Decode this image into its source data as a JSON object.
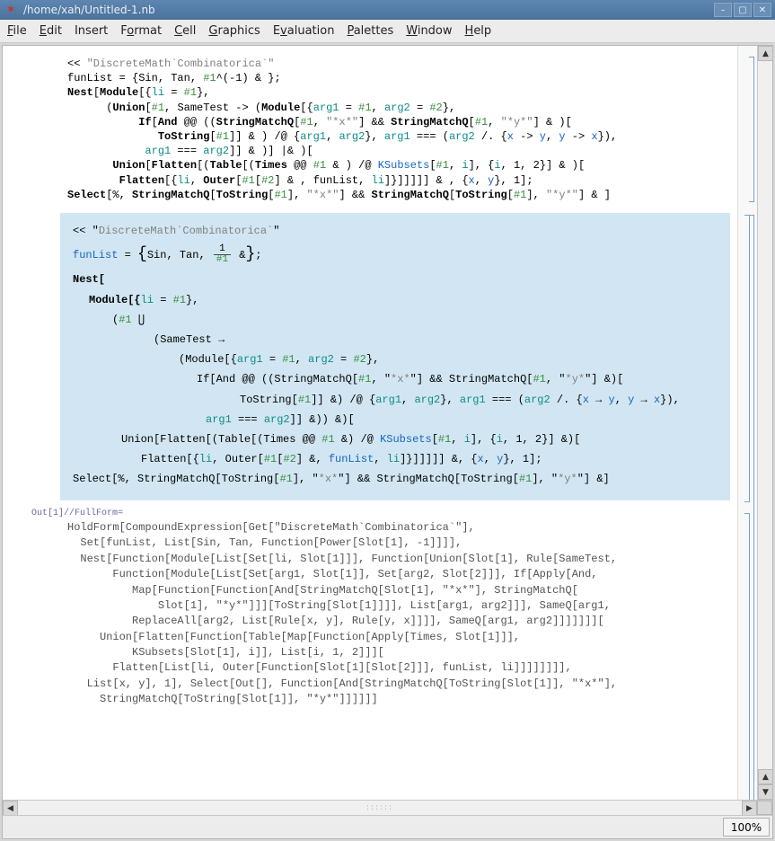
{
  "window": {
    "title": "/home/xah/Untitled-1.nb"
  },
  "menu": {
    "file": "File",
    "edit": "Edit",
    "insert": "Insert",
    "format": "Format",
    "cell": "Cell",
    "graphics": "Graphics",
    "evaluation": "Evaluation",
    "palettes": "Palettes",
    "window": "Window",
    "help": "Help"
  },
  "status": {
    "zoom": "100%"
  },
  "code": {
    "raw_input": "<< \"DiscreteMath`Combinatorica`\"\nfunList = {Sin, Tan, #1^(-1) & };\nNest[Module[{li = #1},\n      (Union[#1, SameTest -> (Module[{arg1 = #1, arg2 = #2},\n           If[And @@ ((StringMatchQ[#1, \"*x*\"] && StringMatchQ[#1, \"*y*\"] & )[\n              ToString[#1]] & ) /@ {arg1, arg2}, arg1 === (arg2 /. {x -> y, y -> x}),\n            arg1 === arg2]] & )] |& )[\n       Union[Flatten[(Table[(Times @@ #1 & ) /@ KSubsets[#1, i], {i, 1, 2}] & )[\n        Flatten[{li, Outer[#1[#2] & , funList, li]}]]]]] & , {x, y}, 1];\nSelect[%, StringMatchQ[ToString[#1], \"*x*\"] && StringMatchQ[ToString[#1], \"*y*\"] & ]",
    "formatted": {
      "l1a": "<< \"",
      "l1b": "DiscreteMath`Combinatorica`",
      "l1c": "\"",
      "l2a": "funList",
      "l2b": " = ",
      "l2c": "Sin",
      "l2d": ", ",
      "l2e": "Tan",
      "l2f": ", ",
      "l2_frac_num": "1",
      "l2_frac_den": "#1",
      "l2g": " &",
      "l2h": ";",
      "l3": "Nest[",
      "l4a": "Module[{",
      "l4b": "li",
      "l4c": " = ",
      "l4d": "#1",
      "l4e": "},",
      "l5a": "(",
      "l5b": "#1",
      "l5c": " ⋃",
      "l6": "(SameTest →",
      "l7a": "(Module[{",
      "l7b": "arg1",
      "l7c": " = ",
      "l7d": "#1",
      "l7e": ", ",
      "l7f": "arg2",
      "l7g": " = ",
      "l7h": "#2",
      "l7i": "},",
      "l8a": "If[And @@ ((StringMatchQ[",
      "l8b": "#1",
      "l8c": ", \"",
      "l8d": "*x*",
      "l8e": "\"] && StringMatchQ[",
      "l8f": "#1",
      "l8g": ", \"",
      "l8h": "*y*",
      "l8i": "\"] &)[",
      "l9a": "ToString[",
      "l9b": "#1",
      "l9c": "]] &) /@ {",
      "l9d": "arg1",
      "l9e": ", ",
      "l9f": "arg2",
      "l9g": "}, ",
      "l9h": "arg1",
      "l9i": " === (",
      "l9j": "arg2",
      "l9k": " /. {",
      "l9l": "x",
      "l9m": " → ",
      "l9n": "y",
      "l9o": ", ",
      "l9p": "y",
      "l9q": " → ",
      "l9r": "x",
      "l9s": "}),",
      "l10a": "arg1",
      "l10b": " === ",
      "l10c": "arg2",
      "l10d": "]] &)) &)[",
      "l11a": "Union[Flatten[(Table[(Times @@ ",
      "l11b": "#1",
      "l11c": " &) /@ ",
      "l11d": "KSubsets",
      "l11e": "[",
      "l11f": "#1",
      "l11g": ", ",
      "l11h": "i",
      "l11i": "], {",
      "l11j": "i",
      "l11k": ", 1, 2}] &)[",
      "l12a": "Flatten[{",
      "l12b": "li",
      "l12c": ", Outer[",
      "l12d": "#1",
      "l12e": "[",
      "l12f": "#2",
      "l12g": "] &, ",
      "l12h": "funList",
      "l12i": ", ",
      "l12j": "li",
      "l12k": "]}]]]]] &, {",
      "l12l": "x",
      "l12m": ", ",
      "l12n": "y",
      "l12o": "}, 1];",
      "l13a": "Select[%, StringMatchQ[ToString[",
      "l13b": "#1",
      "l13c": "], \"",
      "l13d": "*x*",
      "l13e": "\"] && StringMatchQ[ToString[",
      "l13f": "#1",
      "l13g": "], \"",
      "l13h": "*y*",
      "l13i": "\"] &]"
    },
    "out_label": "Out[1]//FullForm=",
    "output": "HoldForm[CompoundExpression[Get[\"DiscreteMath`Combinatorica`\"],\n  Set[funList, List[Sin, Tan, Function[Power[Slot[1], -1]]]],\n  Nest[Function[Module[List[Set[li, Slot[1]]], Function[Union[Slot[1], Rule[SameTest,\n       Function[Module[List[Set[arg1, Slot[1]], Set[arg2, Slot[2]]], If[Apply[And,\n          Map[Function[Function[And[StringMatchQ[Slot[1], \"*x*\"], StringMatchQ[\n              Slot[1], \"*y*\"]]][ToString[Slot[1]]]], List[arg1, arg2]]], SameQ[arg1,\n          ReplaceAll[arg2, List[Rule[x, y], Rule[y, x]]]], SameQ[arg1, arg2]]]]]]][\n     Union[Flatten[Function[Table[Map[Function[Apply[Times, Slot[1]]],\n          KSubsets[Slot[1], i]], List[i, 1, 2]]][\n       Flatten[List[li, Outer[Function[Slot[1][Slot[2]]], funList, li]]]]]]]],\n   List[x, y], 1], Select[Out[], Function[And[StringMatchQ[ToString[Slot[1]], \"*x*\"],\n     StringMatchQ[ToString[Slot[1]], \"*y*\"]]]]]]"
  }
}
